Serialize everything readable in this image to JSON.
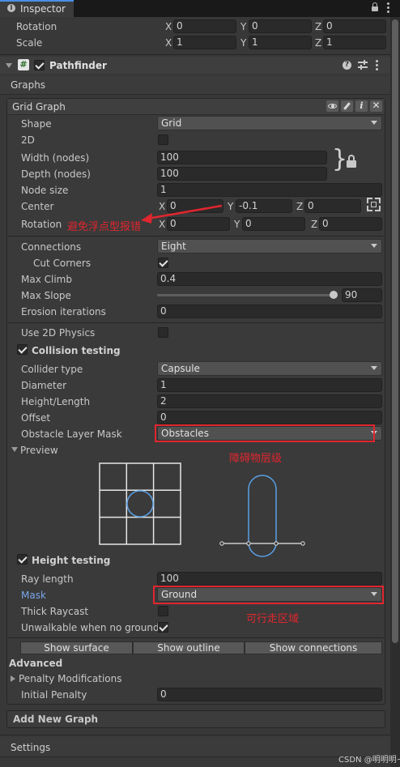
{
  "tab": {
    "title": "Inspector"
  },
  "transform": {
    "rotation": {
      "label": "Rotation",
      "x": "0",
      "y": "0",
      "z": "0"
    },
    "scale": {
      "label": "Scale",
      "x": "1",
      "y": "1",
      "z": "1"
    }
  },
  "axes": {
    "x": "X",
    "y": "Y",
    "z": "Z"
  },
  "component": {
    "title": "Pathfinder",
    "section": "Graphs"
  },
  "grid_graph": {
    "title": "Grid Graph",
    "shape": {
      "label": "Shape",
      "value": "Grid"
    },
    "two_d": {
      "label": "2D"
    },
    "width": {
      "label": "Width (nodes)",
      "value": "100"
    },
    "depth": {
      "label": "Depth (nodes)",
      "value": "100"
    },
    "node_size": {
      "label": "Node size",
      "value": "1"
    },
    "center": {
      "label": "Center",
      "x": "0",
      "y": "-0.1",
      "z": "0"
    },
    "rotation": {
      "label": "Rotation",
      "x": "0",
      "y": "0",
      "z": "0"
    },
    "connections": {
      "label": "Connections",
      "value": "Eight"
    },
    "cut_corners": {
      "label": "Cut Corners"
    },
    "max_climb": {
      "label": "Max Climb",
      "value": "0.4"
    },
    "max_slope": {
      "label": "Max Slope",
      "value": "90"
    },
    "erosion": {
      "label": "Erosion iterations",
      "value": "0"
    },
    "use_2d_physics": {
      "label": "Use 2D Physics"
    },
    "collision_testing": {
      "label": "Collision testing"
    },
    "collider_type": {
      "label": "Collider type",
      "value": "Capsule"
    },
    "diameter": {
      "label": "Diameter",
      "value": "1"
    },
    "height_length": {
      "label": "Height/Length",
      "value": "2"
    },
    "offset": {
      "label": "Offset",
      "value": "0"
    },
    "obstacle_mask": {
      "label": "Obstacle Layer Mask",
      "value": "Obstacles"
    },
    "preview": {
      "label": "Preview"
    },
    "height_testing": {
      "label": "Height testing"
    },
    "ray_length": {
      "label": "Ray length",
      "value": "100"
    },
    "mask": {
      "label": "Mask",
      "value": "Ground"
    },
    "thick_raycast": {
      "label": "Thick Raycast"
    },
    "unwalkable": {
      "label": "Unwalkable when no ground"
    },
    "buttons": {
      "show_surface": "Show surface",
      "show_outline": "Show outline",
      "show_connections": "Show connections"
    },
    "advanced": {
      "label": "Advanced"
    },
    "penalty_mods": {
      "label": "Penalty Modifications"
    },
    "initial_penalty": {
      "label": "Initial Penalty",
      "value": "0"
    }
  },
  "add_new_graph": {
    "label": "Add New Graph"
  },
  "settings": {
    "label": "Settings"
  },
  "annotations": {
    "rotation_note": "避免浮点型报错",
    "obstacle_note": "障碍物层级",
    "walkable_note": "可行走区域"
  },
  "watermark": "CSDN @明明明~",
  "colors": {
    "annotation": "#e0262e",
    "preview_circle": "#5aa0e6",
    "mask_label": "#7aa6e8"
  }
}
